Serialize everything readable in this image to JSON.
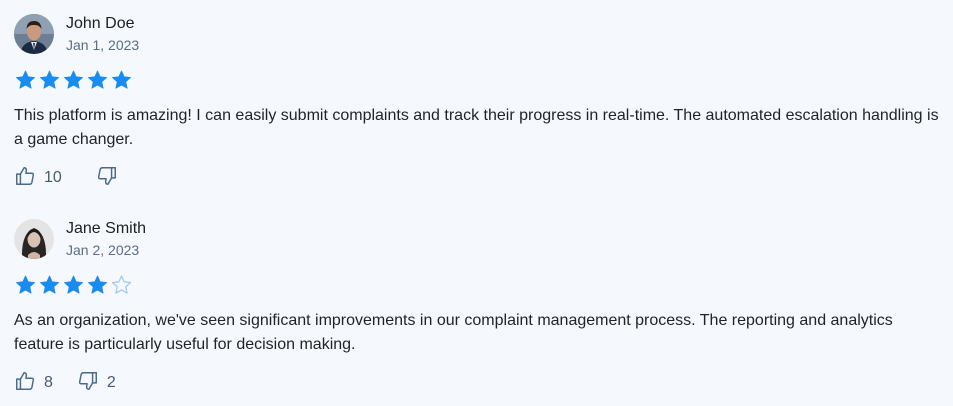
{
  "reviews": [
    {
      "author": "John Doe",
      "date": "Jan 1, 2023",
      "rating": 5,
      "max_rating": 5,
      "text": "This platform is amazing! I can easily submit complaints and track their progress in real-time. The automated escalation handling is a game changer.",
      "likes": "10",
      "dislikes": ""
    },
    {
      "author": "Jane Smith",
      "date": "Jan 2, 2023",
      "rating": 4,
      "max_rating": 5,
      "text": "As an organization, we've seen significant improvements in our complaint management process. The reporting and analytics feature is particularly useful for decision making.",
      "likes": "8",
      "dislikes": "2"
    }
  ],
  "colors": {
    "star_filled": "#1a8cf0",
    "star_empty": "#9cc8f0",
    "icon": "#4a6a8a"
  },
  "icons": {
    "like": "thumbs-up-icon",
    "dislike": "thumbs-down-icon",
    "star": "star-icon"
  }
}
